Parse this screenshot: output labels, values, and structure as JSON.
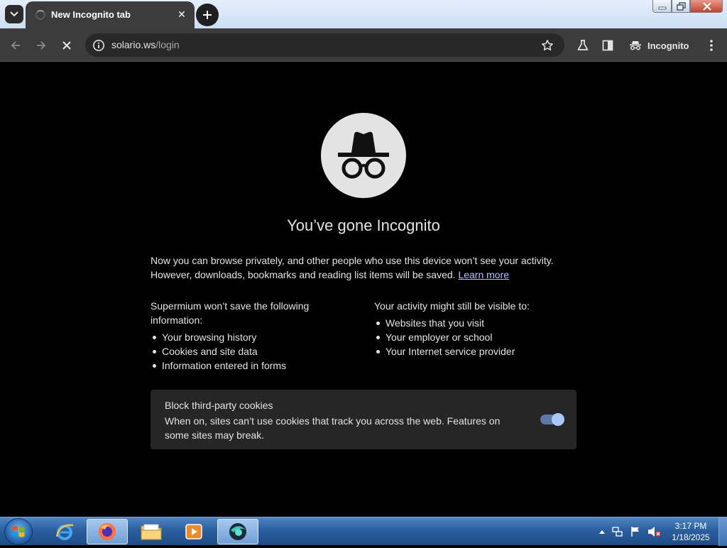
{
  "browser": {
    "tab": {
      "title": "New Incognito tab",
      "close_glyph": "✕"
    },
    "new_tab_glyph": "+",
    "omnibox": {
      "host": "solario.ws",
      "path": "/login"
    },
    "incognito_label": "Incognito"
  },
  "page": {
    "headline": "You’ve gone Incognito",
    "intro": "Now you can browse privately, and other people who use this device won’t see your activity. However, downloads, bookmarks and reading list items will be saved.",
    "learn_more": "Learn more",
    "left_column": {
      "heading": "Supermium won’t save the following information:",
      "items": [
        "Your browsing history",
        "Cookies and site data",
        "Information entered in forms"
      ]
    },
    "right_column": {
      "heading": "Your activity might still be visible to:",
      "items": [
        "Websites that you visit",
        "Your employer or school",
        "Your Internet service provider"
      ]
    },
    "cookie_card": {
      "title": "Block third-party cookies",
      "description": "When on, sites can’t use cookies that track you across the web. Features on some sites may break.",
      "toggle_on": true
    }
  },
  "taskbar": {
    "apps": [
      "internet-explorer",
      "firefox",
      "file-explorer",
      "media-player",
      "supermium"
    ],
    "clock": {
      "time": "3:17 PM",
      "date": "1/18/2025"
    }
  },
  "colors": {
    "accent": "#a8c7fa",
    "background": "#000000",
    "toolbar": "#3c3c3c"
  }
}
